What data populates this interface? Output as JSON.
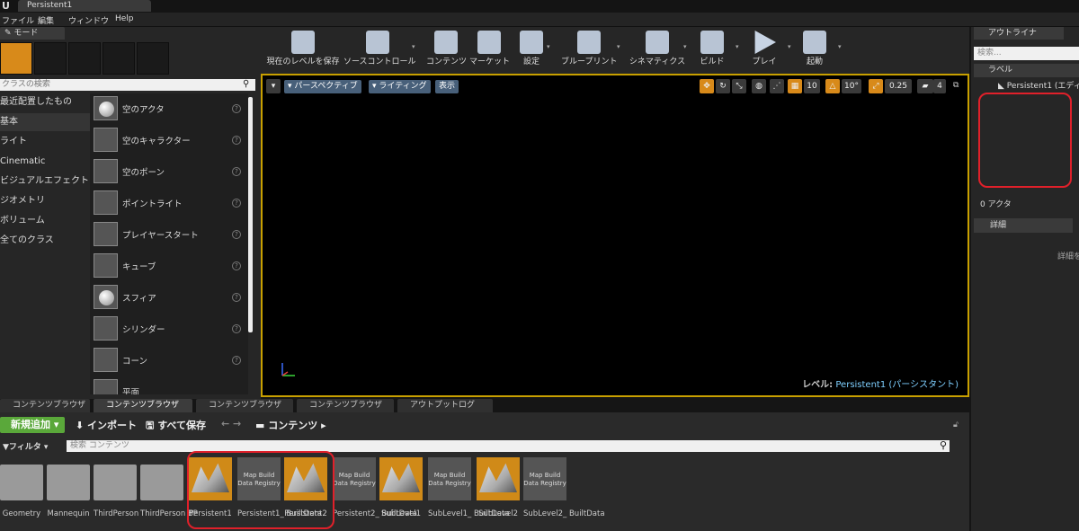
{
  "window": {
    "doc_tab": "Persistent1"
  },
  "menu": [
    "ファイル",
    "編集",
    "ウィンドウ",
    "Help"
  ],
  "modes": {
    "tab": "モード",
    "search_placeholder": "クラスの検索"
  },
  "categories": [
    "最近配置したもの",
    "基本",
    "ライト",
    "Cinematic",
    "ビジュアルエフェクト",
    "ジオメトリ",
    "ボリューム",
    "全てのクラス"
  ],
  "place_items": [
    "空のアクタ",
    "空のキャラクター",
    "空のポーン",
    "ポイントライト",
    "プレイヤースタート",
    "キューブ",
    "スフィア",
    "シリンダー",
    "コーン",
    "平面"
  ],
  "toolbar": [
    "現在のレベルを保存",
    "ソースコントロール",
    "コンテンツ",
    "マーケット",
    "設定",
    "ブループリント",
    "シネマティクス",
    "ビルド",
    "プレイ",
    "起動"
  ],
  "viewport": {
    "perspective": "パースペクティブ",
    "lighting": "ライティング",
    "show": "表示",
    "grid_snap": "10",
    "rot_snap": "10°",
    "scale_snap": "0.25",
    "cam_speed": "4",
    "level_label": "レベル:",
    "level_name": "Persistent1 (パーシスタント)"
  },
  "outliner": {
    "tab": "アウトライナ",
    "search_placeholder": "検索...",
    "column": "ラベル",
    "row": "Persistent1 (エディ",
    "count": "0 アクタ"
  },
  "details": {
    "tab": "詳細",
    "hint": "詳細を"
  },
  "bottom_tabs": [
    "コンテンツブラウザ",
    "コンテンツブラウザ",
    "コンテンツブラウザ",
    "コンテンツブラウザ",
    "アウトプットログ"
  ],
  "content_browser": {
    "add_new": "新規追加",
    "import": "インポート",
    "save_all": "すべて保存",
    "path": "コンテンツ",
    "filter": "フィルタ",
    "search_placeholder": "検索 コンテンツ",
    "mbd_text": "Map Build Data Registry",
    "assets": [
      {
        "name": "Geometry",
        "kind": "folder"
      },
      {
        "name": "Mannequin",
        "kind": "folder"
      },
      {
        "name": "ThirdPerson",
        "kind": "folder"
      },
      {
        "name": "ThirdPerson BP",
        "kind": "folder"
      },
      {
        "name": "Persistent1",
        "kind": "map"
      },
      {
        "name": "Persistent1_ BuiltData",
        "kind": "mbd"
      },
      {
        "name": "Persistent2",
        "kind": "map"
      },
      {
        "name": "Persistent2_ BuiltData",
        "kind": "mbd"
      },
      {
        "name": "SubLevel1",
        "kind": "map"
      },
      {
        "name": "SubLevel1_ BuiltData",
        "kind": "mbd"
      },
      {
        "name": "SubLevel2",
        "kind": "map"
      },
      {
        "name": "SubLevel2_ BuiltData",
        "kind": "mbd"
      }
    ]
  },
  "colors": {
    "highlight": "#e0202a",
    "accent": "#d88a1a",
    "viewport_border": "#c8a000"
  }
}
